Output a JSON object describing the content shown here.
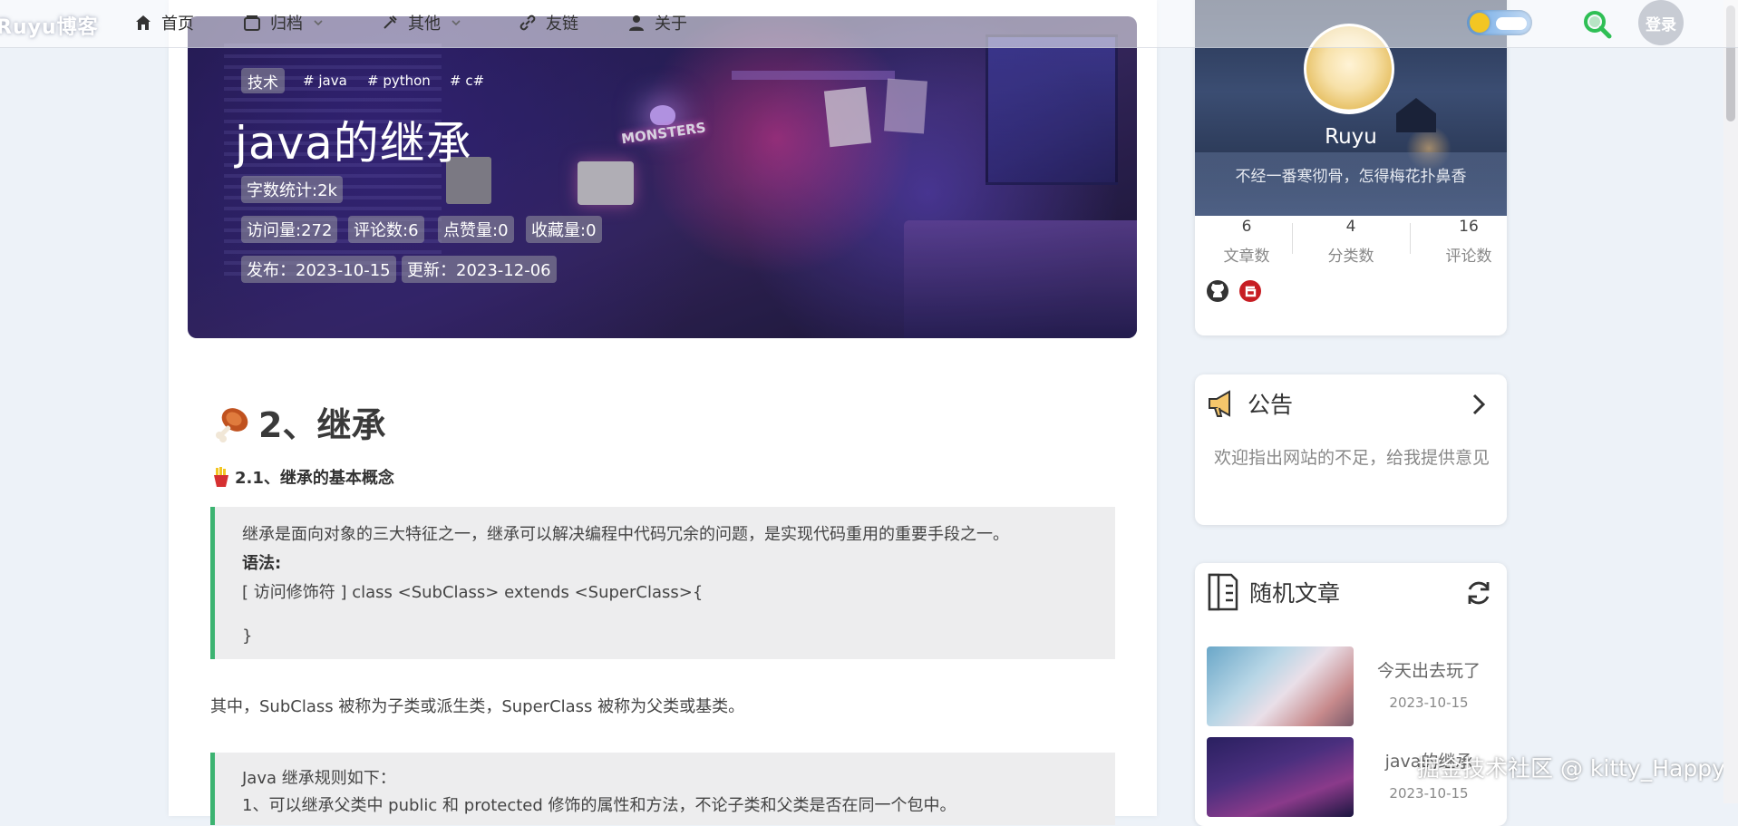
{
  "site_title": "Ruyu博客",
  "nav": {
    "items": [
      {
        "label": "首页",
        "icon": "home-icon"
      },
      {
        "label": "归档",
        "icon": "archive-icon"
      },
      {
        "label": "其他",
        "icon": "puzzle-icon"
      },
      {
        "label": "友链",
        "icon": "link-icon"
      },
      {
        "label": "关于",
        "icon": "user-icon"
      }
    ],
    "login_label": "登录",
    "search_icon": "search-icon",
    "theme_toggle_icon": "theme-toggle-icon"
  },
  "article": {
    "category": "技术",
    "tags": [
      "# java",
      "# python",
      "# c#"
    ],
    "title": "java的继承",
    "word_count": "字数统计:2k",
    "views": "访问量:272",
    "comments": "评论数:6",
    "likes": "点赞量:0",
    "favorites": "收藏量:0",
    "published": "发布：2023-10-15",
    "updated": "更新：2023-12-06",
    "h2": "2、继承",
    "h3": "2.1、继承的基本概念",
    "quote1": {
      "line1": "继承是面向对象的三大特征之一，继承可以解决编程中代码冗余的问题，是实现代码重用的重要手段之一。",
      "line2": "语法:",
      "line3": "[ 访问修饰符 ] class <SubClass> extends <SuperClass>{",
      "line4": "}"
    },
    "paragraph": "其中，SubClass 被称为子类或派生类，SuperClass 被称为父类或基类。",
    "quote2": {
      "line1": "Java 继承规则如下：",
      "line2": "1、可以继承父类中 public 和 protected 修饰的属性和方法，不论子类和父类是否在同一个包中。"
    }
  },
  "profile": {
    "name": "Ruyu",
    "motto": "不经一番寒彻骨，怎得梅花扑鼻香",
    "stats": [
      {
        "num": "6",
        "label": "文章数"
      },
      {
        "num": "4",
        "label": "分类数"
      },
      {
        "num": "16",
        "label": "评论数"
      }
    ]
  },
  "notice": {
    "title": "公告",
    "body": "欢迎指出网站的不足，给我提供意见"
  },
  "random_posts": {
    "title": "随机文章",
    "items": [
      {
        "title": "今天出去玩了",
        "date": "2023-10-15"
      },
      {
        "title": "java的继承",
        "date": "2023-10-15"
      }
    ]
  },
  "watermark": "掘金技术社区 @ kitty_Happy",
  "colors": {
    "accent_green": "#3cb371",
    "page_bg": "#edf2f8",
    "search_green": "#2fbf55",
    "github_dark": "#333333",
    "gitee_red": "#c71d23"
  }
}
